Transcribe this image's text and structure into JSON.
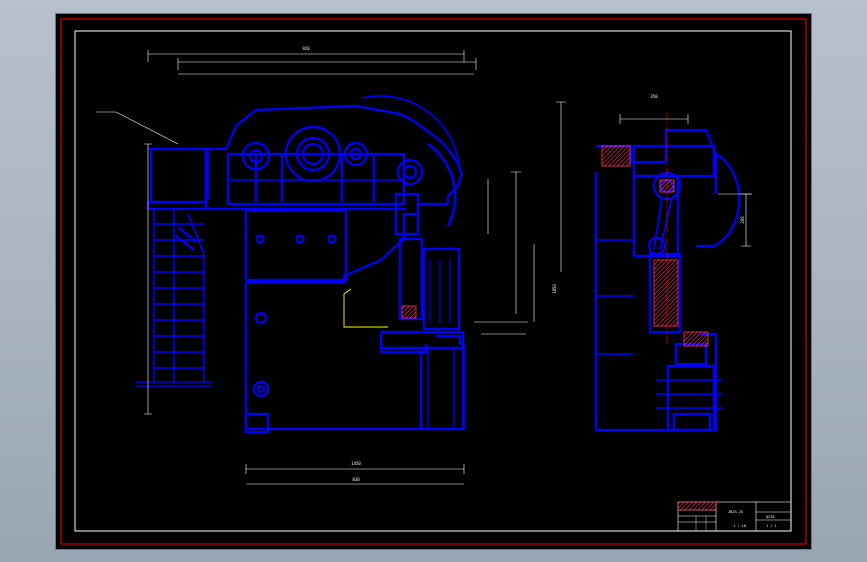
{
  "colors": {
    "background": "#000000",
    "outer_border": "#ff0000",
    "inner_border": "#ffffff",
    "geometry": "#0000ff",
    "dimensions": "#ffffff",
    "section_hatch": "#ff3366",
    "centerline": "#ff0000",
    "highlight": "#ffff00",
    "desktop": "#a9b3c0"
  },
  "drawing": {
    "front_view_dims": [
      "920",
      "1850",
      "1450",
      "830"
    ],
    "side_view_dims": [
      "350",
      "200"
    ]
  },
  "title_block": {
    "drawing_name": "JB23-25",
    "scale_label": "1 : 10",
    "material": "Q235",
    "sheet": "1 / 1"
  }
}
